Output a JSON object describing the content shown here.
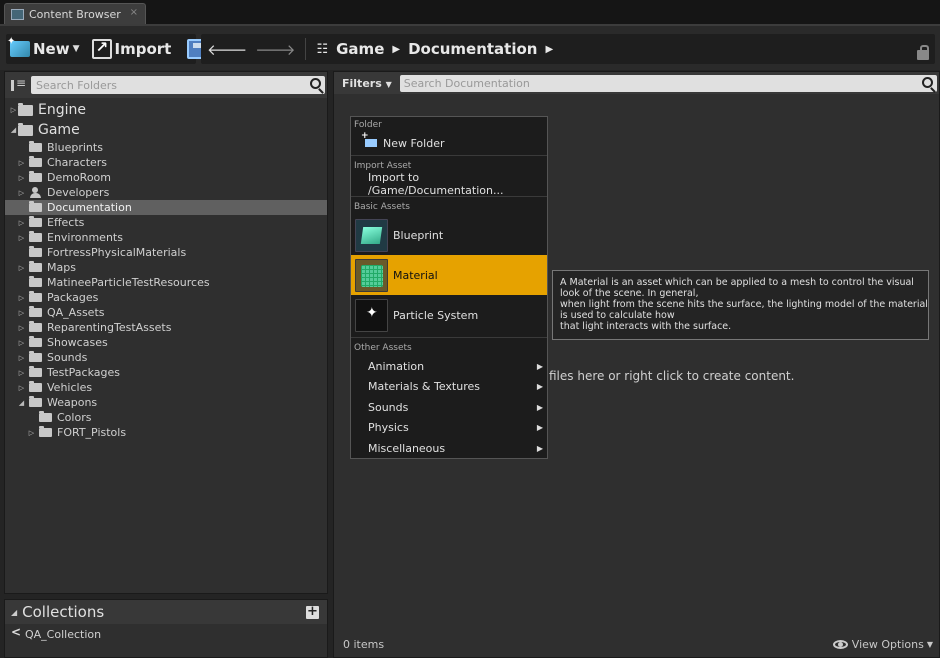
{
  "tab": {
    "title": "Content Browser",
    "close": "×"
  },
  "toolbar": {
    "new_label": "New",
    "import_label": "Import",
    "breadcrumbs": [
      "Game",
      "Documentation"
    ]
  },
  "folders": {
    "search_placeholder": "Search Folders",
    "engine": "Engine",
    "game": "Game",
    "items": [
      "Blueprints",
      "Characters",
      "DemoRoom",
      "Developers",
      "Documentation",
      "Effects",
      "Environments",
      "FortressPhysicalMaterials",
      "Maps",
      "MatineeParticleTestResources",
      "Packages",
      "QA_Assets",
      "ReparentingTestAssets",
      "Showcases",
      "Sounds",
      "TestPackages",
      "Vehicles",
      "Weapons"
    ],
    "weapons_children": [
      "Colors",
      "FORT_Pistols"
    ]
  },
  "collections": {
    "title": "Collections",
    "items": [
      "QA_Collection"
    ]
  },
  "content": {
    "filters_label": "Filters",
    "search_placeholder": "Search Documentation",
    "empty_hint": "files here or right click to create content.",
    "item_count": "0 items",
    "view_options": "View Options"
  },
  "menu": {
    "folder_header": "Folder",
    "new_folder": "New Folder",
    "import_header": "Import Asset",
    "import_to": "Import to /Game/Documentation...",
    "basic_header": "Basic Assets",
    "blueprint": "Blueprint",
    "material": "Material",
    "particle_system": "Particle System",
    "other_header": "Other Assets",
    "animation": "Animation",
    "materials_textures": "Materials & Textures",
    "sounds": "Sounds",
    "physics": "Physics",
    "misc": "Miscellaneous"
  },
  "tooltip": {
    "line1": "A Material is an asset which can be applied to a mesh to control the visual",
    "line2": "look of the scene. In general,",
    "line3": "when light from the scene hits the surface, the lighting model of the material",
    "line4": "is used to calculate how",
    "line5": "that light interacts with the surface."
  },
  "colors": {
    "highlight": "#e6a200",
    "selected_row": "#606060"
  }
}
